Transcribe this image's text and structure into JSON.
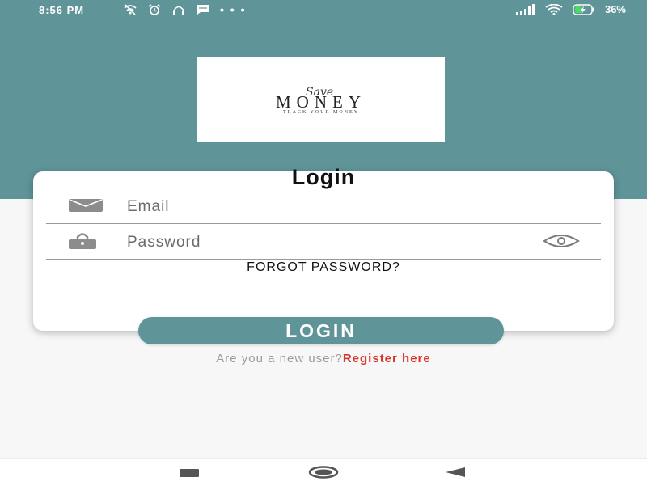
{
  "status_bar": {
    "time": "8:56 PM",
    "battery": "36%",
    "left_icons": [
      "wifi-off-icon",
      "alarm-icon",
      "headset-icon",
      "message-icon",
      "more-dots-icon"
    ],
    "right_icons": [
      "signal-icon",
      "wifi-icon",
      "battery-charging-icon"
    ],
    "more": "• • •"
  },
  "logo": {
    "script": "Save",
    "main": "MONEY",
    "tagline": "TRACK YOUR MONEY"
  },
  "login_card": {
    "title": "Login",
    "email": {
      "placeholder": "Email",
      "value": "",
      "icon": "envelope-icon"
    },
    "password": {
      "placeholder": "Password",
      "value": "",
      "icon": "lock-icon",
      "toggle_icon": "eye-icon"
    },
    "forgot_label": "FORGOT PASSWORD?"
  },
  "login_button": {
    "label": "LOGIN"
  },
  "register": {
    "prompt": "Are you a new user?",
    "link": "Register here"
  },
  "nav_bar": {
    "items": [
      "recent-apps-icon",
      "home-icon",
      "back-icon"
    ]
  },
  "colors": {
    "primary": "#5f9599",
    "link": "#d9352e",
    "background": "#f7f7f7"
  }
}
